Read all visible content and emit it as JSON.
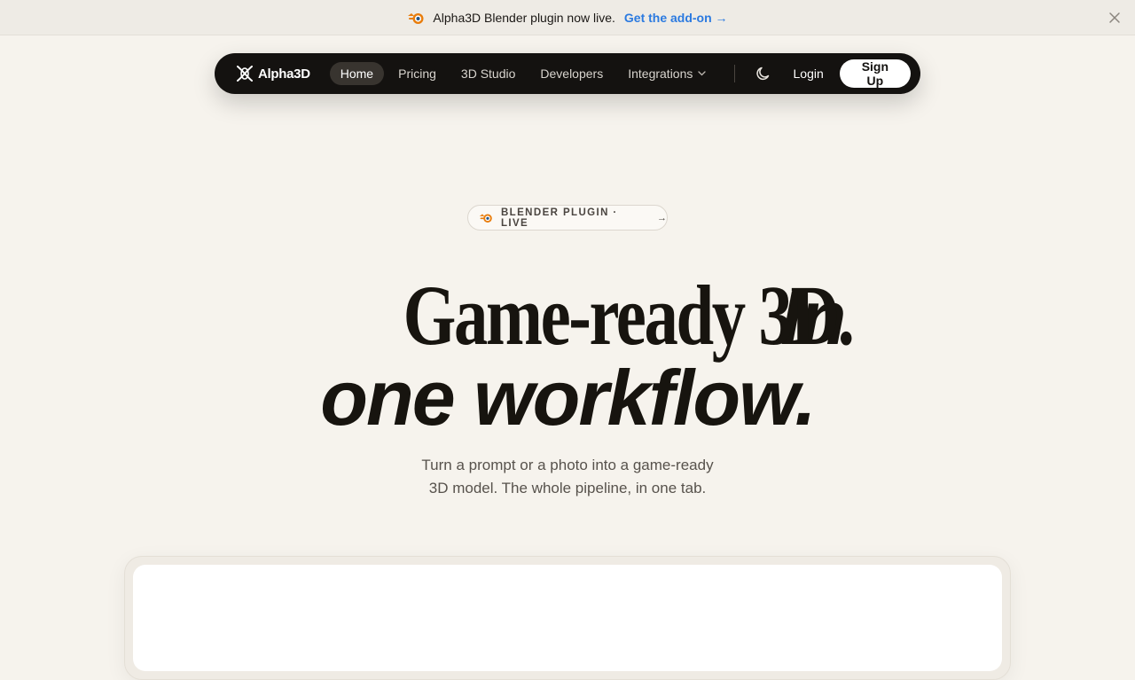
{
  "announcement": {
    "message": "Alpha3D Blender plugin now live.",
    "cta": "Get the add-on →"
  },
  "nav": {
    "brand": "Alpha3D",
    "items": [
      {
        "label": "Home",
        "active": true
      },
      {
        "label": "Pricing"
      },
      {
        "label": "3D Studio"
      },
      {
        "label": "Developers"
      },
      {
        "label": "Integrations"
      }
    ],
    "login": "Login",
    "signup": "Sign Up"
  },
  "badge": {
    "label": "BLENDER PLUGIN · LIVE",
    "arrow": "→"
  },
  "hero": {
    "headline_serif": "Game-ready 3D.",
    "headline_italic_1": "In",
    "headline_italic_2": "one workflow.",
    "subtitle_line1": "Turn a prompt or a photo into a game-ready",
    "subtitle_line2": "3D model. The whole pipeline, in one tab."
  },
  "colors": {
    "background": "#f6f3ed",
    "nav_bg": "#141210",
    "link_blue": "#2b7ae0",
    "blender_orange": "#e87d0d",
    "blender_blue": "#265787"
  }
}
